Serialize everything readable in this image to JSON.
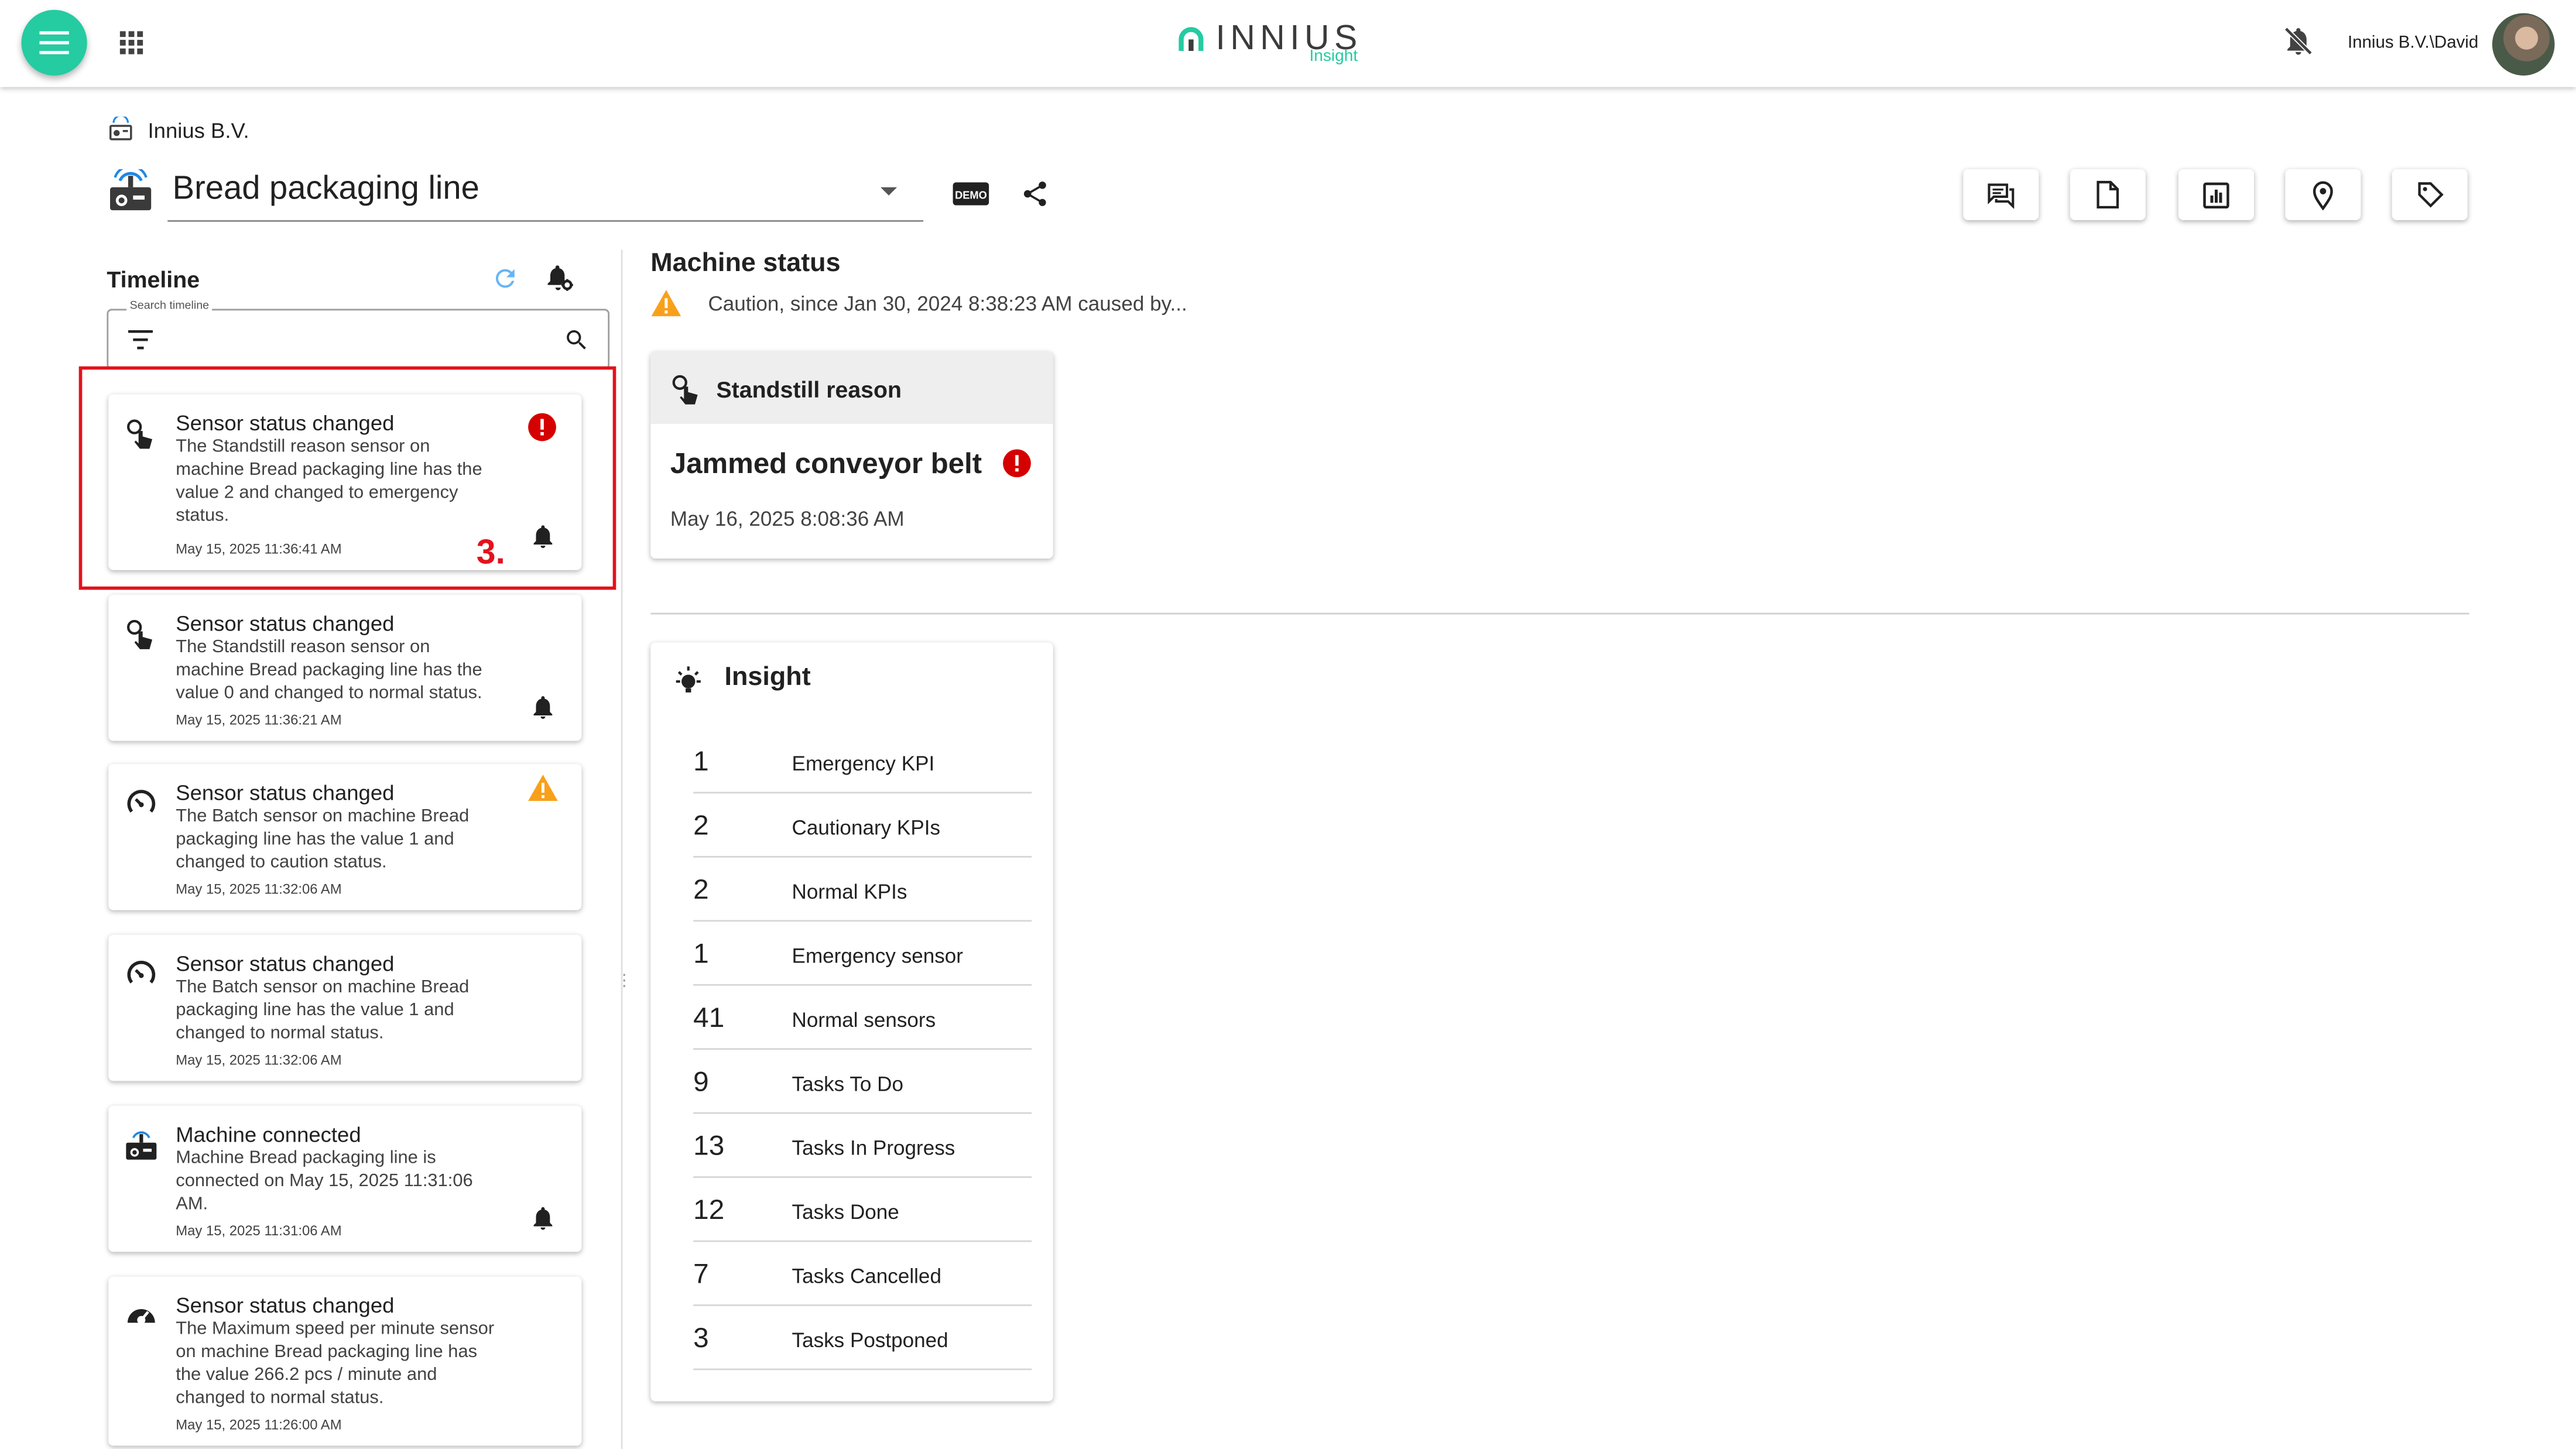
{
  "header": {
    "logo_text": "INNIUS",
    "logo_sub": "Insight",
    "user": "Innius B.V.\\David",
    "icons": [
      "menu-icon",
      "apps-grid-icon",
      "notifications-off-icon",
      "avatar"
    ],
    "accent": "#25cba1"
  },
  "breadcrumb": {
    "company": "Innius B.V."
  },
  "machine": {
    "name": "Bread packaging line",
    "demo_badge": "DEMO"
  },
  "toolbar": {
    "buttons": [
      "chat-icon",
      "document-icon",
      "report-icon",
      "location-icon",
      "tag-icon"
    ]
  },
  "timeline": {
    "title": "Timeline",
    "search_label": "Search timeline",
    "search_value": "",
    "items": [
      {
        "title": "Sensor status changed",
        "description": "The Standstill reason sensor on machine Bread packaging line has the value 2 and changed to emergency status.",
        "date": "May 15, 2025 11:36:41 AM",
        "status": "emergency",
        "icon": "touch-sensor-icon",
        "has_bell": true
      },
      {
        "title": "Sensor status changed",
        "description": "The Standstill reason sensor on machine Bread packaging line has the value 0 and changed to normal status.",
        "date": "May 15, 2025 11:36:21 AM",
        "status": "normal",
        "icon": "touch-sensor-icon",
        "has_bell": true
      },
      {
        "title": "Sensor status changed",
        "description": "The Batch sensor on machine Bread packaging line has the value 1 and changed to caution status.",
        "date": "May 15, 2025 11:32:06 AM",
        "status": "caution",
        "icon": "gauge-icon",
        "has_bell": false
      },
      {
        "title": "Sensor status changed",
        "description": "The Batch sensor on machine Bread packaging line has the value 1 and changed to normal status.",
        "date": "May 15, 2025 11:32:06 AM",
        "status": "normal",
        "icon": "gauge-icon",
        "has_bell": false
      },
      {
        "title": "Machine connected",
        "description": "Machine Bread packaging line is connected on May 15, 2025 11:31:06 AM.",
        "date": "May 15, 2025 11:31:06 AM",
        "status": "normal",
        "icon": "machine-icon",
        "has_bell": true
      },
      {
        "title": "Sensor status changed",
        "description": "The Maximum speed per minute sensor on machine Bread packaging line has the value 266.2 pcs / minute and changed to normal status.",
        "date": "May 15, 2025 11:26:00 AM",
        "status": "normal",
        "icon": "speed-icon",
        "has_bell": false
      }
    ]
  },
  "annotation": {
    "step": "3."
  },
  "machine_status": {
    "title": "Machine status",
    "status_text": "Caution, since Jan 30, 2024 8:38:23 AM caused by...",
    "standstill": {
      "header": "Standstill reason",
      "value": "Jammed conveyor belt",
      "date": "May 16, 2025 8:08:36 AM"
    }
  },
  "insight": {
    "title": "Insight",
    "rows": [
      {
        "count": "1",
        "label": "Emergency KPI"
      },
      {
        "count": "2",
        "label": "Cautionary KPIs"
      },
      {
        "count": "2",
        "label": "Normal KPIs"
      },
      {
        "count": "1",
        "label": "Emergency sensor"
      },
      {
        "count": "41",
        "label": "Normal sensors"
      },
      {
        "count": "9",
        "label": "Tasks To Do"
      },
      {
        "count": "13",
        "label": "Tasks In Progress"
      },
      {
        "count": "12",
        "label": "Tasks Done"
      },
      {
        "count": "7",
        "label": "Tasks Cancelled"
      },
      {
        "count": "3",
        "label": "Tasks Postponed"
      }
    ]
  },
  "colors": {
    "emergency": "#d50000",
    "caution": "#f9a01b",
    "highlight": "#e3121b"
  }
}
